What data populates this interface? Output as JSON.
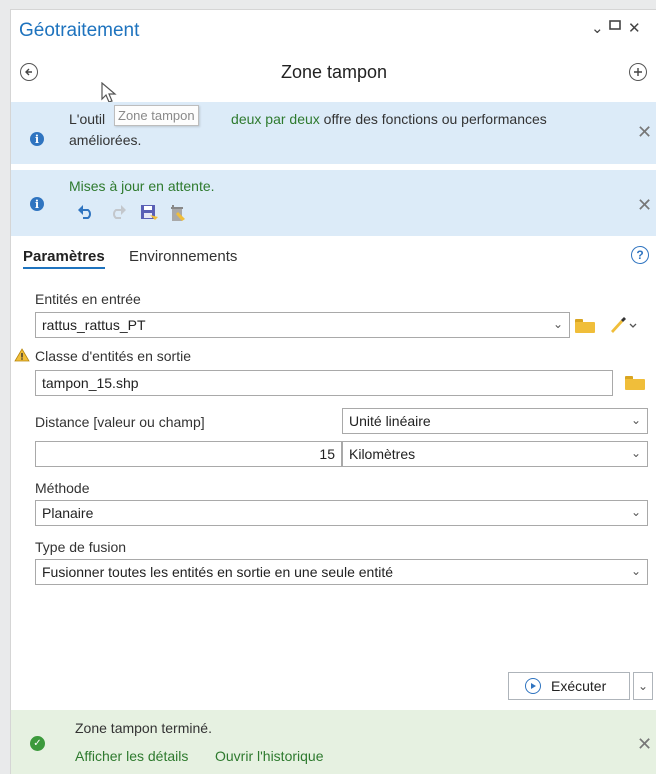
{
  "pane": {
    "title": "Géotraitement",
    "controls": {
      "minimize": "⌄",
      "maximize": "▫",
      "close": "✕"
    }
  },
  "toolbar": {
    "tool_title": "Zone tampon"
  },
  "tooltip": {
    "text": "Zone tampon"
  },
  "banner_upgrade": {
    "text_before": "L'outil",
    "text_link": "deux par deux",
    "text_after": "offre des fonctions ou performances améliorées."
  },
  "banner_updates": {
    "text": "Mises à jour en attente."
  },
  "tabs": {
    "params": "Paramètres",
    "env": "Environnements"
  },
  "params": {
    "input_label": "Entités en entrée",
    "input_value": "rattus_rattus_PT",
    "output_label": "Classe d'entités en sortie",
    "output_value": "tampon_15.shp",
    "distance_label": "Distance [valeur ou champ]",
    "unit_mode": "Unité linéaire",
    "distance_value": "15",
    "distance_unit": "Kilomètres",
    "method_label": "Méthode",
    "method_value": "Planaire",
    "dissolve_label": "Type de fusion",
    "dissolve_value": "Fusionner toutes les entités en sortie en une seule entité"
  },
  "run": {
    "label": "Exécuter"
  },
  "status": {
    "text": "Zone tampon terminé.",
    "details_link": "Afficher les détails",
    "history_link": "Ouvrir l'historique"
  },
  "colors": {
    "accent": "#1e73be",
    "info_bg": "#dcebf8",
    "success_bg": "#e6f1e1",
    "folder": "#f0be3a"
  }
}
